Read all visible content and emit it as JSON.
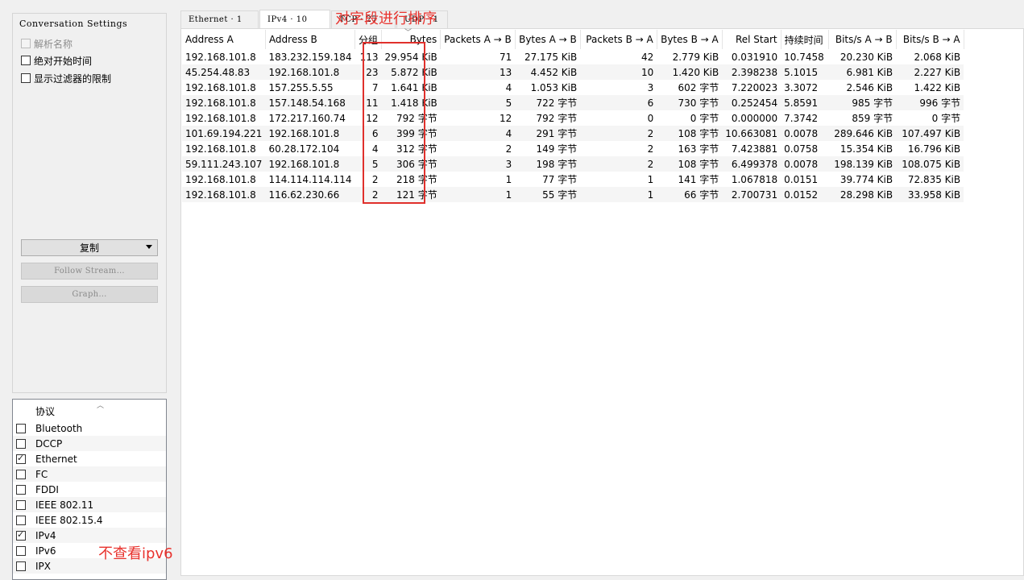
{
  "settings": {
    "title": "Conversation Settings",
    "options": [
      {
        "label": "解析名称",
        "checked": false,
        "enabled": false
      },
      {
        "label": "绝对开始时间",
        "checked": false,
        "enabled": true
      },
      {
        "label": "显示过滤器的限制",
        "checked": false,
        "enabled": true
      }
    ],
    "copy_button": "复制",
    "follow_stream_button": "Follow Stream…",
    "graph_button": "Graph…"
  },
  "protocols": {
    "header": "协议",
    "items": [
      {
        "label": "Bluetooth",
        "checked": false
      },
      {
        "label": "DCCP",
        "checked": false
      },
      {
        "label": "Ethernet",
        "checked": true
      },
      {
        "label": "FC",
        "checked": false
      },
      {
        "label": "FDDI",
        "checked": false
      },
      {
        "label": "IEEE 802.11",
        "checked": false
      },
      {
        "label": "IEEE 802.15.4",
        "checked": false
      },
      {
        "label": "IPv4",
        "checked": true
      },
      {
        "label": "IPv6",
        "checked": false
      },
      {
        "label": "IPX",
        "checked": false
      }
    ]
  },
  "tabs": [
    {
      "label": "Ethernet · 1",
      "active": false
    },
    {
      "label": "IPv4 · 10",
      "active": true
    },
    {
      "label": "TCP · 27",
      "active": false
    },
    {
      "label": "UDP · 1",
      "active": false
    }
  ],
  "table": {
    "columns": [
      "Address A",
      "Address B",
      "分组",
      "Bytes",
      "Packets A → B",
      "Bytes A → B",
      "Packets B → A",
      "Bytes B → A",
      "Rel Start",
      "持续时间",
      "Bits/s A → B",
      "Bits/s B → A"
    ],
    "rows": [
      [
        "192.168.101.8",
        "183.232.159.184",
        "113",
        "29.954 KiB",
        "71",
        "27.175 KiB",
        "42",
        "2.779 KiB",
        "0.031910",
        "10.7458",
        "20.230 KiB",
        "2.068 KiB"
      ],
      [
        "45.254.48.83",
        "192.168.101.8",
        "23",
        "5.872 KiB",
        "13",
        "4.452 KiB",
        "10",
        "1.420 KiB",
        "2.398238",
        "5.1015",
        "6.981 KiB",
        "2.227 KiB"
      ],
      [
        "192.168.101.8",
        "157.255.5.55",
        "7",
        "1.641 KiB",
        "4",
        "1.053 KiB",
        "3",
        "602 字节",
        "7.220023",
        "3.3072",
        "2.546 KiB",
        "1.422 KiB"
      ],
      [
        "192.168.101.8",
        "157.148.54.168",
        "11",
        "1.418 KiB",
        "5",
        "722 字节",
        "6",
        "730 字节",
        "0.252454",
        "5.8591",
        "985 字节",
        "996 字节"
      ],
      [
        "192.168.101.8",
        "172.217.160.74",
        "12",
        "792 字节",
        "12",
        "792 字节",
        "0",
        "0 字节",
        "0.000000",
        "7.3742",
        "859 字节",
        "0 字节"
      ],
      [
        "101.69.194.221",
        "192.168.101.8",
        "6",
        "399 字节",
        "4",
        "291 字节",
        "2",
        "108 字节",
        "10.663081",
        "0.0078",
        "289.646 KiB",
        "107.497 KiB"
      ],
      [
        "192.168.101.8",
        "60.28.172.104",
        "4",
        "312 字节",
        "2",
        "149 字节",
        "2",
        "163 字节",
        "7.423881",
        "0.0758",
        "15.354 KiB",
        "16.796 KiB"
      ],
      [
        "59.111.243.107",
        "192.168.101.8",
        "5",
        "306 字节",
        "3",
        "198 字节",
        "2",
        "108 字节",
        "6.499378",
        "0.0078",
        "198.139 KiB",
        "108.075 KiB"
      ],
      [
        "192.168.101.8",
        "114.114.114.114",
        "2",
        "218 字节",
        "1",
        "77 字节",
        "1",
        "141 字节",
        "1.067818",
        "0.0151",
        "39.774 KiB",
        "72.835 KiB"
      ],
      [
        "192.168.101.8",
        "116.62.230.66",
        "2",
        "121 字节",
        "1",
        "55 字节",
        "1",
        "66 字节",
        "2.700731",
        "0.0152",
        "28.298 KiB",
        "33.958 KiB"
      ]
    ]
  },
  "annotations": {
    "sort_note": "对字段进行排序",
    "ipv6_note": "不查看ipv6"
  }
}
